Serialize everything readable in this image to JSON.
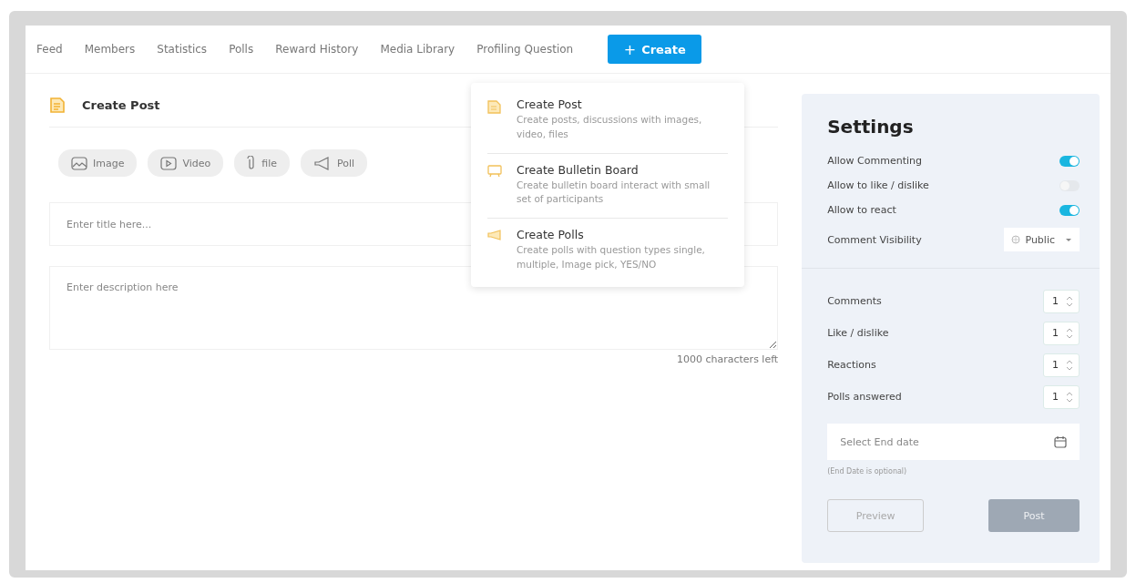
{
  "nav": {
    "tabs": [
      {
        "label": "Feed",
        "selected": false
      },
      {
        "label": "Members",
        "selected": false
      },
      {
        "label": "Statistics",
        "selected": false
      },
      {
        "label": "Polls",
        "selected": false
      },
      {
        "label": "Reward History",
        "selected": false
      },
      {
        "label": "Media Library",
        "selected": false
      },
      {
        "label": "Profiling Question",
        "selected": false
      }
    ],
    "create_button": {
      "icon": "+",
      "label": "Create"
    }
  },
  "editor": {
    "title": "Create Post",
    "attachments": [
      {
        "kind": "image",
        "label": "Image"
      },
      {
        "kind": "video",
        "label": "Video"
      },
      {
        "kind": "file",
        "label": "file"
      },
      {
        "kind": "poll",
        "label": "Poll"
      }
    ],
    "title_field": {
      "placeholder": "Enter title here..."
    },
    "description_field": {
      "placeholder": "Enter description here"
    },
    "counter": "1000 characters left"
  },
  "create_menu": [
    {
      "kind": "post",
      "title": "Create Post",
      "description": "Create posts, discussions with images, video, files"
    },
    {
      "kind": "bulletin",
      "title": "Create Bulletin Board",
      "description": "Create bulletin board interact with small set of participants"
    },
    {
      "kind": "polls",
      "title": "Create Polls",
      "description": "Create polls with question types single, multiple, Image pick, YES/NO"
    }
  ],
  "settings": {
    "title": "Settings",
    "toggles": [
      {
        "label": "Allow Commenting",
        "on": true
      },
      {
        "label": "Allow to like / dislike",
        "on": false
      },
      {
        "label": "Allow to react",
        "on": true
      }
    ],
    "visibility": {
      "label": "Comment Visibility",
      "value": "Public"
    },
    "limits": [
      {
        "label": "Comments",
        "value": "1"
      },
      {
        "label": "Like / dislike",
        "value": "1"
      },
      {
        "label": "Reactions",
        "value": "1"
      },
      {
        "label": "Polls answered",
        "value": "1"
      }
    ],
    "end_date": {
      "placeholder": "Select End date",
      "hint": "(End Date is optional)"
    },
    "buttons": [
      {
        "kind": "outline",
        "label": "Preview",
        "disabled": true
      },
      {
        "kind": "filled",
        "label": "Post",
        "disabled": true
      }
    ]
  }
}
